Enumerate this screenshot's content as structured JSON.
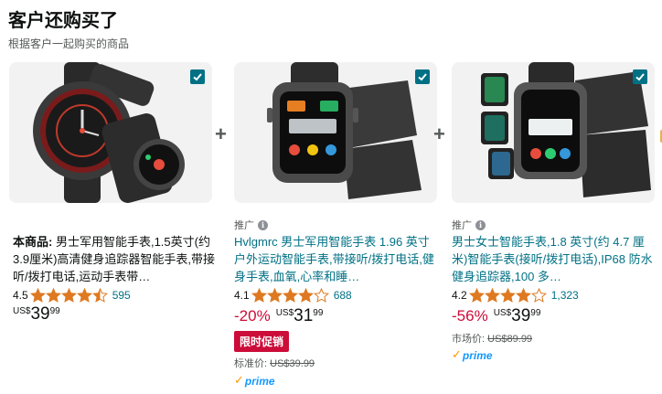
{
  "section": {
    "title": "客户还购买了",
    "subtitle": "根据客户一起购买的商品"
  },
  "plus_symbol": "+",
  "products": [
    {
      "title_prefix": "本商品:",
      "title": "男士军用智能手表,1.5英寸(约3.9厘米)高清健身追踪器智能手表,带接听/拨打电话,运动手表带…",
      "rating": "4.5",
      "stars": 4.5,
      "review_count": "595",
      "currency": "US$",
      "price_whole": "39",
      "price_fraction": "99",
      "checked": true
    },
    {
      "sponsored_label": "推广",
      "title": "Hvlgmrc 男士军用智能手表 1.96 英寸户外运动智能手表,带接听/拨打电话,健身手表,血氧,心率和睡…",
      "rating": "4.1",
      "stars": 4,
      "review_count": "688",
      "discount": "-20%",
      "currency": "US$",
      "price_whole": "31",
      "price_fraction": "99",
      "deal_badge": "限时促销",
      "list_price_label": "标准价:",
      "list_price": "US$39.99",
      "prime_label": "prime",
      "checked": true
    },
    {
      "sponsored_label": "推广",
      "title": "男士女士智能手表,1.8 英寸(约 4.7 厘米)智能手表(接听/拨打电话),IP68 防水健身追踪器,100 多…",
      "rating": "4.2",
      "stars": 4,
      "review_count": "1,323",
      "discount": "-56%",
      "currency": "US$",
      "price_whole": "39",
      "price_fraction": "99",
      "list_price_label": "市场价:",
      "list_price": "US$89.99",
      "prime_label": "prime",
      "checked": true
    }
  ],
  "colors": {
    "link": "#007185",
    "deal_red": "#cc0c39",
    "star": "#de7921",
    "prime_blue": "#1399ff",
    "checkbox": "#007185"
  }
}
